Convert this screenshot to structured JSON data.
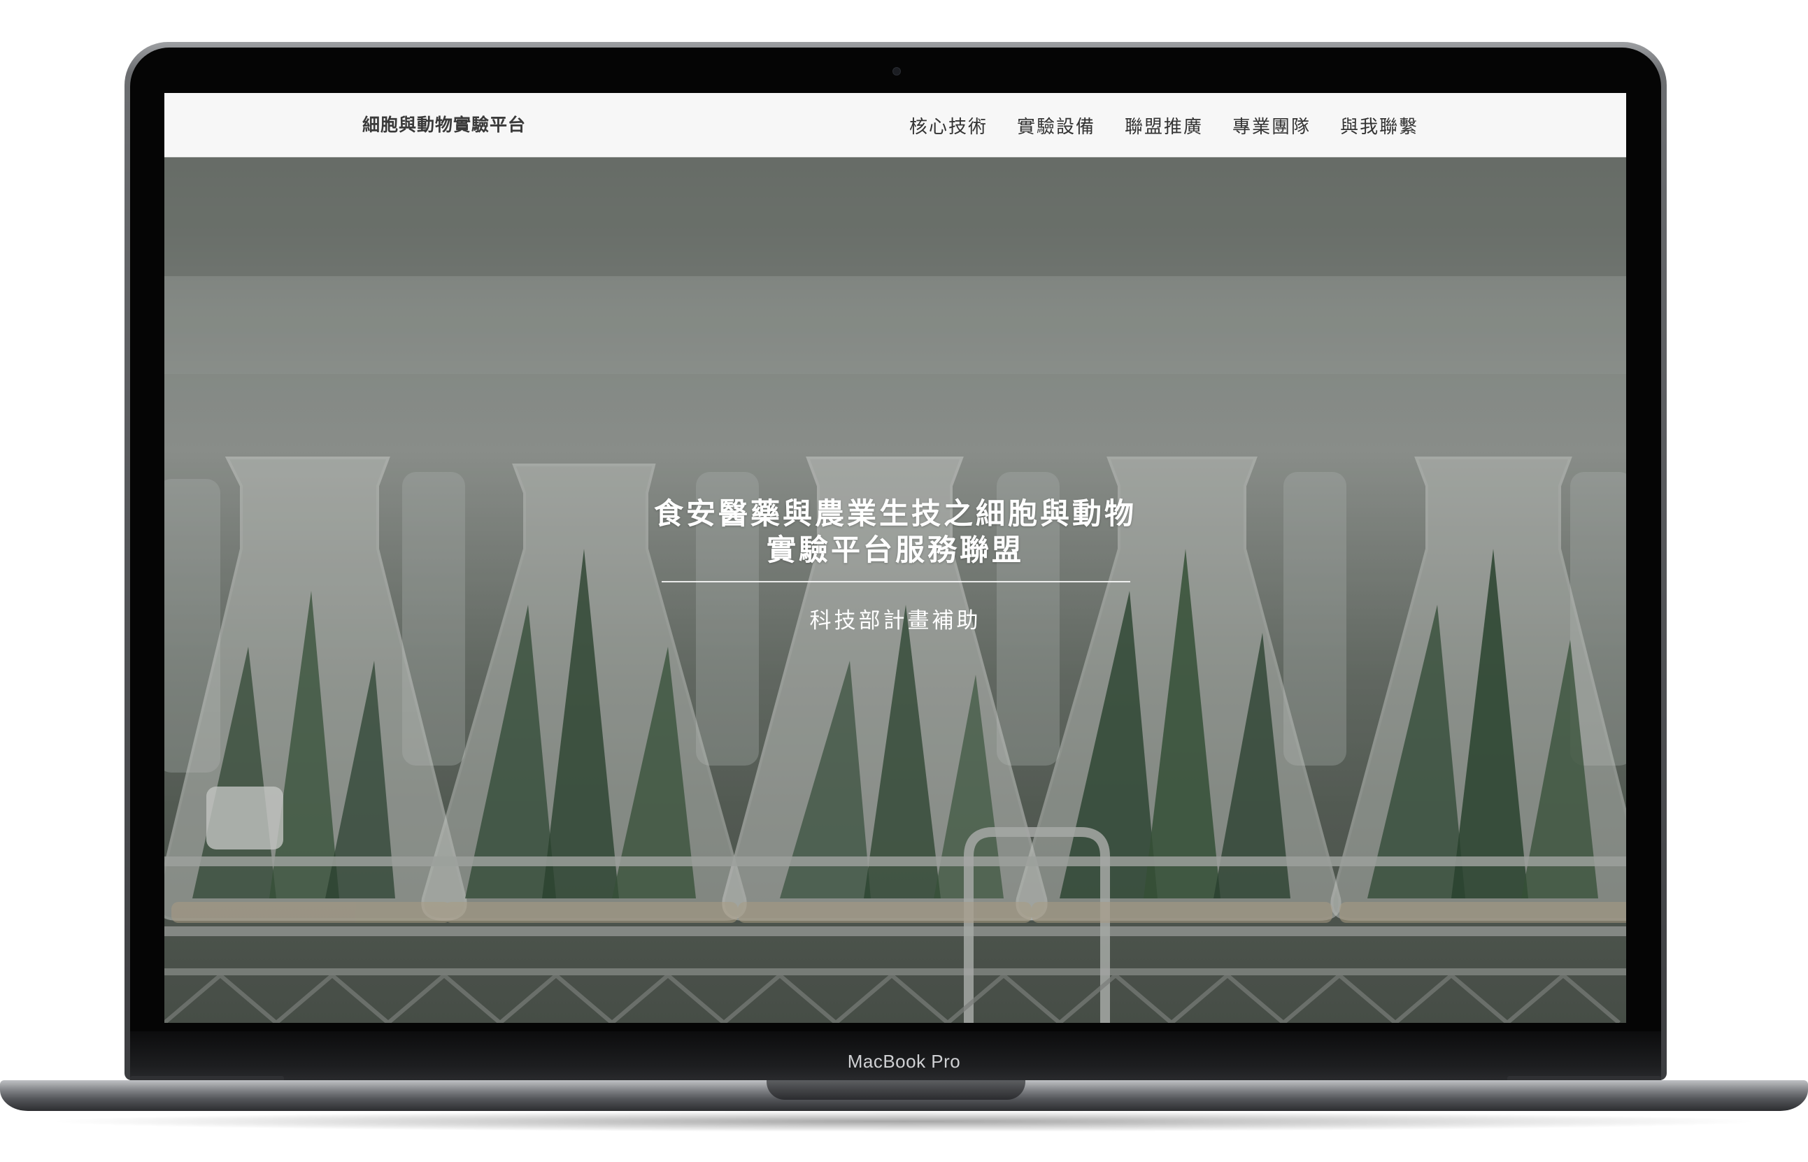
{
  "site": {
    "brand": "細胞與動物實驗平台",
    "nav": [
      "核心技術",
      "實驗設備",
      "聯盟推廣",
      "專業團隊",
      "與我聯繫"
    ]
  },
  "hero": {
    "title_line1": "食安醫藥與農業生技之細胞與動物",
    "title_line2": "實驗平台服務聯盟",
    "subtitle": "科技部計畫補助",
    "background": "lab-flasks-with-plant-seedlings-photo"
  },
  "device": {
    "label": "MacBook Pro"
  },
  "colors": {
    "navbar_bg": "#f7f7f7",
    "nav_text": "#333333",
    "hero_text": "#ffffff",
    "bezel": "#050505",
    "body": "#6c6e71"
  }
}
